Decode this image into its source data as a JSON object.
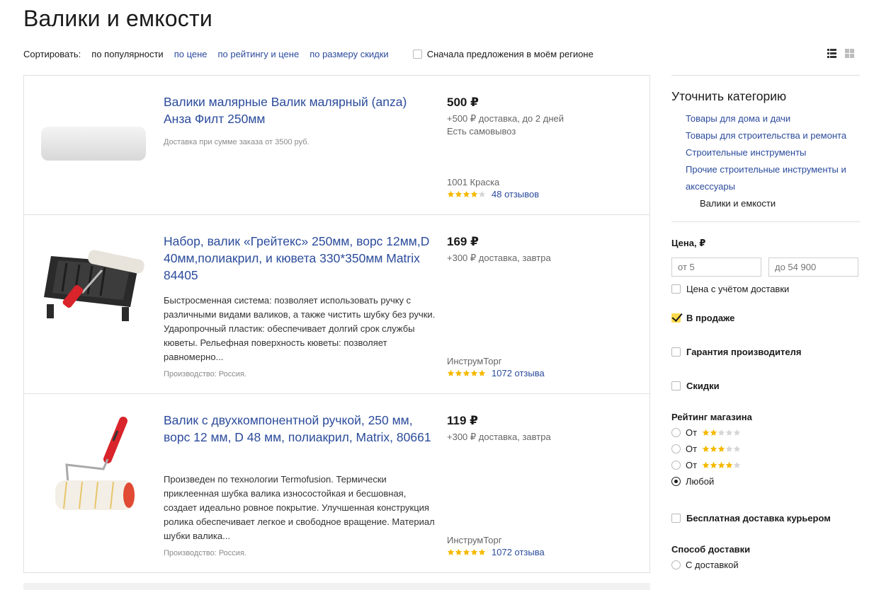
{
  "page": {
    "title": "Валики и емкости"
  },
  "sort": {
    "label": "Сортировать:",
    "options": [
      "по популярности",
      "по цене",
      "по рейтингу и цене",
      "по размеру скидки"
    ],
    "active_index": 0,
    "region_checkbox_label": "Сначала предложения в моём регионе"
  },
  "view": {
    "options": [
      "list-view-icon",
      "grid-view-icon"
    ]
  },
  "products": [
    {
      "title": "Валики малярные Валик малярный (anza) Анза Филт 250мм",
      "description": "",
      "note": "Доставка при сумме заказа от 3500 руб.",
      "price": "500 ₽",
      "delivery": "+500 ₽ доставка, до 2 дней",
      "pickup": "Есть самовывоз",
      "shop": "1001 Краска",
      "rating": 4,
      "reviews": "48 отзывов"
    },
    {
      "title": "Набор, валик «Грейтекс» 250мм, ворс 12мм,D 40мм,полиакрил, и кювета 330*350мм Matrix 84405",
      "description": "Быстросменная система: позволяет использовать ручку с различными видами валиков, а также чистить шубку без ручки. Ударопрочный пластик: обеспечивает долгий срок службы кюветы. Рельефная поверхность кюветы: позволяет равномерно...",
      "note": "Производство: Россия.",
      "price": "169 ₽",
      "delivery": "+300 ₽ доставка, завтра",
      "pickup": "",
      "shop": "ИнструмТорг",
      "rating": 5,
      "reviews": "1072 отзыва"
    },
    {
      "title": "Валик с двухкомпонентной ручкой, 250 мм, ворс 12 мм, D 48 мм, полиакрил, Matrix, 80661",
      "description": "Произведен по технологии Termofusion. Термически приклеенная шубка валика износостойкая и бесшовная, создает идеально ровное покрытие. Улучшенная конструкция ролика обеспечивает легкое и свободное вращение. Материал шубки валика...",
      "note": "Производство: Россия.",
      "price": "119 ₽",
      "delivery": "+300 ₽ доставка, завтра",
      "pickup": "",
      "shop": "ИнструмТорг",
      "rating": 5,
      "reviews": "1072 отзыва"
    }
  ],
  "sidebar": {
    "category_title": "Уточнить категорию",
    "categories": [
      "Товары для дома и дачи",
      "Товары для строительства и ремонта",
      "Строительные инструменты",
      "Прочие строительные инструменты и аксессуары"
    ],
    "current_category": "Валики и емкости",
    "price": {
      "title": "Цена, ₽",
      "from_placeholder": "от 5",
      "to_placeholder": "до 54 900",
      "with_delivery_label": "Цена с учётом доставки"
    },
    "on_sale_label": "В продаже",
    "on_sale_checked": true,
    "warranty_label": "Гарантия производителя",
    "discounts_label": "Скидки",
    "shop_rating": {
      "title": "Рейтинг магазина",
      "options": [
        {
          "label": "От",
          "stars": 2
        },
        {
          "label": "От",
          "stars": 3
        },
        {
          "label": "От",
          "stars": 4
        },
        {
          "label": "Любой",
          "stars": 0
        }
      ],
      "selected_index": 3
    },
    "free_courier_label": "Бесплатная доставка курьером",
    "delivery_method": {
      "title": "Способ доставки",
      "options": [
        "С доставкой"
      ]
    }
  },
  "colors": {
    "link": "#2b4b9b",
    "star": "#f6b900",
    "checkbox_accent": "#ffdb4d"
  }
}
